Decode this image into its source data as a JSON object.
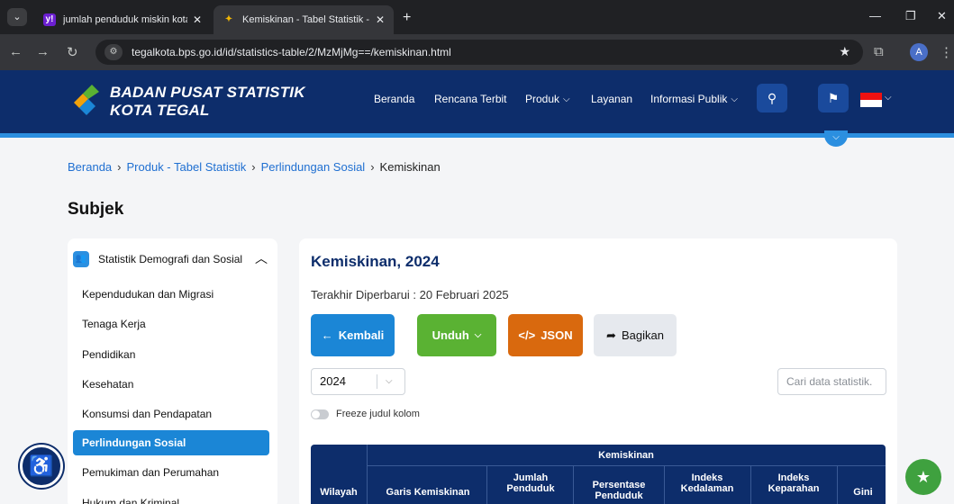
{
  "browser": {
    "tabs": [
      {
        "title": "jumlah penduduk miskin kota t",
        "favicon": "yahoo-icon"
      },
      {
        "title": "Kemiskinan - Tabel Statistik - B",
        "favicon": "bps-icon"
      }
    ],
    "url": "tegalkota.bps.go.id/id/statistics-table/2/MzMjMg==/kemiskinan.html",
    "profile_initial": "A"
  },
  "header": {
    "brand_line1": "BADAN PUSAT STATISTIK",
    "brand_line2": "KOTA TEGAL",
    "menu": [
      "Beranda",
      "Rencana Terbit",
      "Produk",
      "Layanan",
      "Informasi Publik"
    ]
  },
  "breadcrumb": [
    "Beranda",
    "Produk - Tabel Statistik",
    "Perlindungan Sosial",
    "Kemiskinan"
  ],
  "subject_heading": "Subjek",
  "sidebar": {
    "group_label": "Statistik Demografi dan Sosial",
    "items": [
      "Kependudukan dan Migrasi",
      "Tenaga Kerja",
      "Pendidikan",
      "Kesehatan",
      "Konsumsi dan Pendapatan",
      "Perlindungan Sosial",
      "Pemukiman dan Perumahan",
      "Hukum dan Kriminal"
    ],
    "active_index": 5
  },
  "panel": {
    "title": "Kemiskinan, 2024",
    "updated": "Terakhir Diperbarui : 20 Februari 2025",
    "buttons": {
      "back": "Kembali",
      "download": "Unduh",
      "json": "JSON",
      "share": "Bagikan"
    },
    "year": "2024",
    "search_placeholder": "Cari data statistik.",
    "freeze_label": "Freeze judul kolom",
    "table": {
      "group_header": "Kemiskinan",
      "row_header": "Wilayah",
      "columns": [
        "Garis Kemiskinan",
        "Jumlah Penduduk",
        "Persentase Penduduk",
        "Indeks Kedalaman",
        "Indeks Keparahan",
        "Gini"
      ]
    }
  },
  "colors": {
    "navy": "#0d2d6b",
    "blue": "#1b86d6",
    "green": "#5ab233",
    "orange": "#d9690e"
  }
}
